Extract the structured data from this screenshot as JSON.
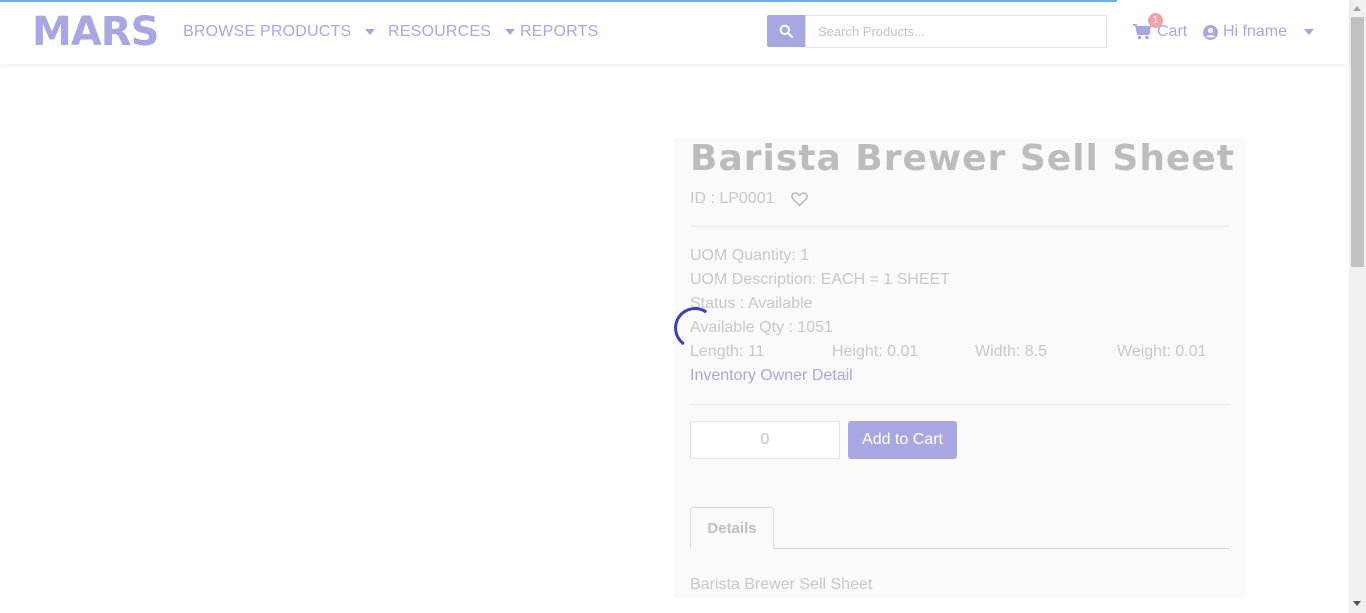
{
  "header": {
    "logo": "MARS",
    "nav": {
      "browse_products": "BROWSE PRODUCTS",
      "resources": "RESOURCES",
      "reports": "REPORTS"
    },
    "search": {
      "placeholder": "Search Products..."
    },
    "cart": {
      "label": "Cart",
      "count": "1"
    },
    "user": {
      "greeting": "Hi fname"
    }
  },
  "product": {
    "title": "Barista Brewer Sell Sheet",
    "id": "ID : LP0001",
    "uom_quantity": "UOM Quantity: 1",
    "uom_description": "UOM Description: EACH = 1 SHEET",
    "status": "Status : Available",
    "available_qty": "Available Qty : 1051",
    "length": "Length: 11",
    "height": "Height: 0.01",
    "width": "Width: 8.5",
    "weight": "Weight: 0.01",
    "inventory_owner_link": "Inventory Owner Detail",
    "quantity_value": "0",
    "add_to_cart": "Add to Cart",
    "tabs": {
      "details": "Details"
    },
    "details_text": "Barista Brewer Sell Sheet"
  },
  "colors": {
    "accent": "#a9a7e2",
    "spinner": "#3b3fb5",
    "badge": "#f2a3a8"
  }
}
